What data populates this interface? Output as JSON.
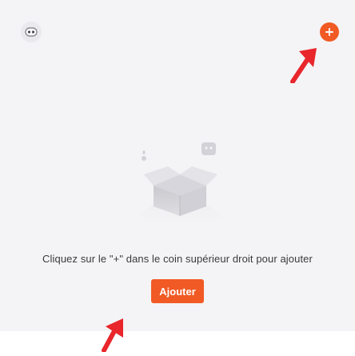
{
  "header": {
    "assistant_icon": "robot-face-icon",
    "add_icon": "plus-circle-icon",
    "accent_color": "#f15a24"
  },
  "empty_state": {
    "illustration_icon": "empty-box-icon",
    "message": "Cliquez sur le \"+\" dans le coin supérieur droit pour ajouter",
    "add_button_label": "Ajouter"
  },
  "annotations": {
    "arrow_icon": "red-arrow-icon",
    "arrow_color": "#e8262b"
  }
}
